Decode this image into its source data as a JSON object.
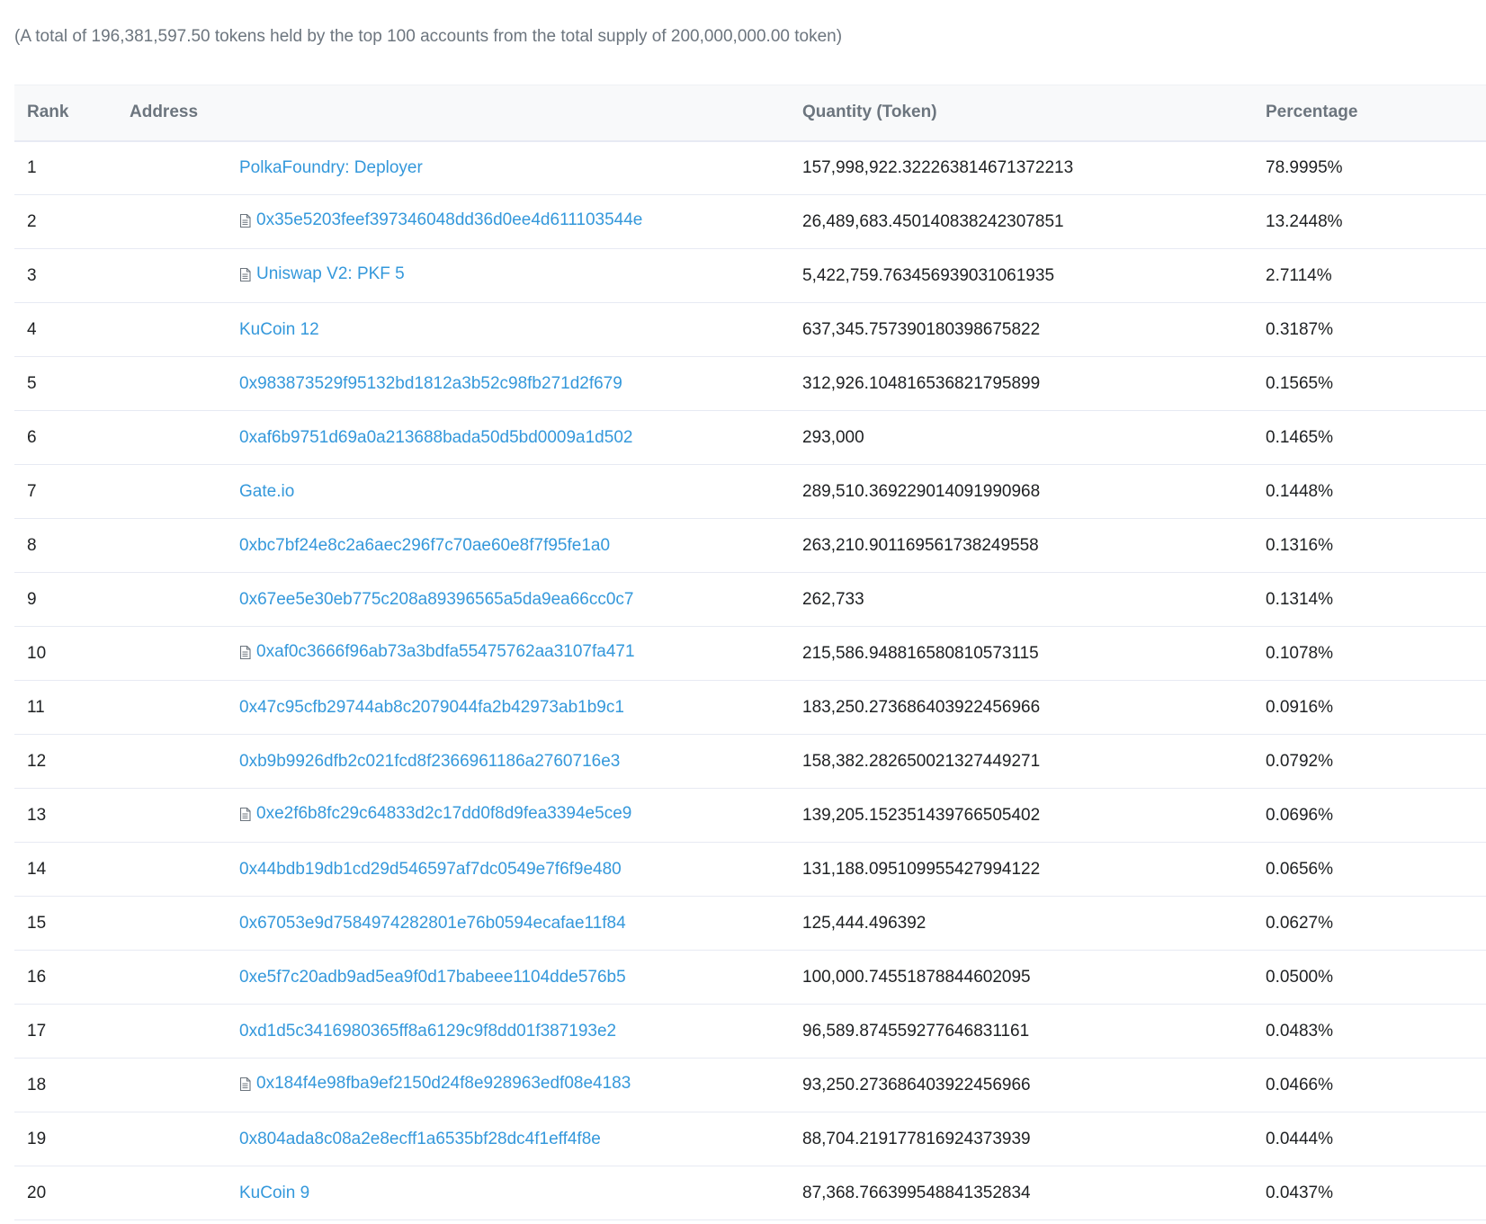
{
  "summary": "(A total of 196,381,597.50 tokens held by the top 100 accounts from the total supply of 200,000,000.00 token)",
  "table": {
    "headers": {
      "rank": "Rank",
      "address": "Address",
      "quantity": "Quantity (Token)",
      "percentage": "Percentage"
    },
    "rows": [
      {
        "rank": "1",
        "address": "PolkaFoundry: Deployer",
        "contract": false,
        "quantity": "157,998,922.322263814671372213",
        "percentage": "78.9995%"
      },
      {
        "rank": "2",
        "address": "0x35e5203feef397346048dd36d0ee4d611103544e",
        "contract": true,
        "quantity": "26,489,683.450140838242307851",
        "percentage": "13.2448%"
      },
      {
        "rank": "3",
        "address": "Uniswap V2: PKF 5",
        "contract": true,
        "quantity": "5,422,759.763456939031061935",
        "percentage": "2.7114%"
      },
      {
        "rank": "4",
        "address": "KuCoin 12",
        "contract": false,
        "quantity": "637,345.757390180398675822",
        "percentage": "0.3187%"
      },
      {
        "rank": "5",
        "address": "0x983873529f95132bd1812a3b52c98fb271d2f679",
        "contract": false,
        "quantity": "312,926.104816536821795899",
        "percentage": "0.1565%"
      },
      {
        "rank": "6",
        "address": "0xaf6b9751d69a0a213688bada50d5bd0009a1d502",
        "contract": false,
        "quantity": "293,000",
        "percentage": "0.1465%"
      },
      {
        "rank": "7",
        "address": "Gate.io",
        "contract": false,
        "quantity": "289,510.369229014091990968",
        "percentage": "0.1448%"
      },
      {
        "rank": "8",
        "address": "0xbc7bf24e8c2a6aec296f7c70ae60e8f7f95fe1a0",
        "contract": false,
        "quantity": "263,210.901169561738249558",
        "percentage": "0.1316%"
      },
      {
        "rank": "9",
        "address": "0x67ee5e30eb775c208a89396565a5da9ea66cc0c7",
        "contract": false,
        "quantity": "262,733",
        "percentage": "0.1314%"
      },
      {
        "rank": "10",
        "address": "0xaf0c3666f96ab73a3bdfa55475762aa3107fa471",
        "contract": true,
        "quantity": "215,586.948816580810573115",
        "percentage": "0.1078%"
      },
      {
        "rank": "11",
        "address": "0x47c95cfb29744ab8c2079044fa2b42973ab1b9c1",
        "contract": false,
        "quantity": "183,250.273686403922456966",
        "percentage": "0.0916%"
      },
      {
        "rank": "12",
        "address": "0xb9b9926dfb2c021fcd8f2366961186a2760716e3",
        "contract": false,
        "quantity": "158,382.282650021327449271",
        "percentage": "0.0792%"
      },
      {
        "rank": "13",
        "address": "0xe2f6b8fc29c64833d2c17dd0f8d9fea3394e5ce9",
        "contract": true,
        "quantity": "139,205.152351439766505402",
        "percentage": "0.0696%"
      },
      {
        "rank": "14",
        "address": "0x44bdb19db1cd29d546597af7dc0549e7f6f9e480",
        "contract": false,
        "quantity": "131,188.095109955427994122",
        "percentage": "0.0656%"
      },
      {
        "rank": "15",
        "address": "0x67053e9d7584974282801e76b0594ecafae11f84",
        "contract": false,
        "quantity": "125,444.496392",
        "percentage": "0.0627%"
      },
      {
        "rank": "16",
        "address": "0xe5f7c20adb9ad5ea9f0d17babeee1104dde576b5",
        "contract": false,
        "quantity": "100,000.74551878844602095",
        "percentage": "0.0500%"
      },
      {
        "rank": "17",
        "address": "0xd1d5c3416980365ff8a6129c9f8dd01f387193e2",
        "contract": false,
        "quantity": "96,589.874559277646831161",
        "percentage": "0.0483%"
      },
      {
        "rank": "18",
        "address": "0x184f4e98fba9ef2150d24f8e928963edf08e4183",
        "contract": true,
        "quantity": "93,250.273686403922456966",
        "percentage": "0.0466%"
      },
      {
        "rank": "19",
        "address": "0x804ada8c08a2e8ecff1a6535bf28dc4f1eff4f8e",
        "contract": false,
        "quantity": "88,704.219177816924373939",
        "percentage": "0.0444%"
      },
      {
        "rank": "20",
        "address": "KuCoin 9",
        "contract": false,
        "quantity": "87,368.766399548841352834",
        "percentage": "0.0437%"
      }
    ]
  },
  "colors": {
    "link": "#3498db",
    "muted": "#6c757e",
    "header_bg": "#f8f9fa",
    "border": "#e7eaf3"
  },
  "icons": {
    "contract": "contract-file-icon"
  }
}
